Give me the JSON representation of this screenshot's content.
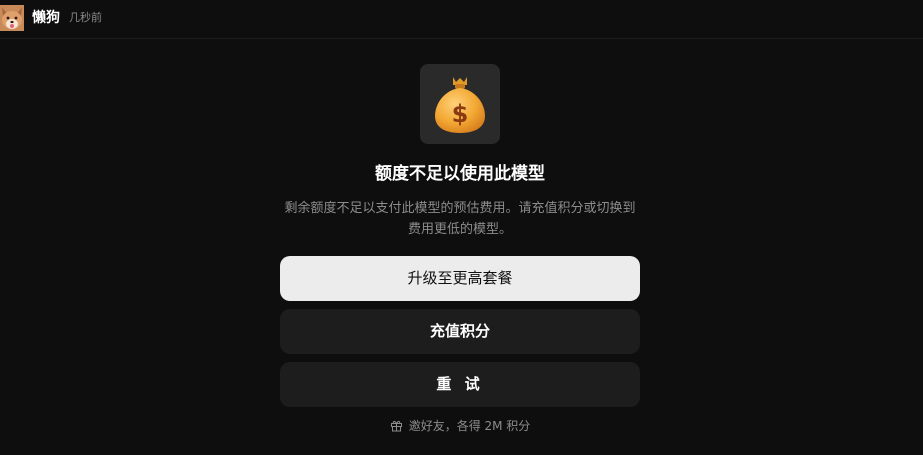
{
  "header": {
    "username": "懒狗",
    "timestamp": "几秒前",
    "avatar_icon": "shiba-dog-avatar"
  },
  "dialog": {
    "icon": "money-bag-icon",
    "title": "额度不足以使用此模型",
    "description": "剩余额度不足以支付此模型的预估费用。请充值积分或切换到费用更低的模型。",
    "buttons": {
      "upgrade": "升级至更高套餐",
      "recharge": "充值积分",
      "retry": "重 试"
    },
    "invite": {
      "icon": "gift-icon",
      "text": "邀好友，各得 2M 积分"
    }
  },
  "colors": {
    "background": "#0e0e0e",
    "primary_button": "#ececec",
    "secondary_button": "#1d1d1d",
    "muted_text": "#8c8c8c",
    "bag": "#f3a833"
  }
}
